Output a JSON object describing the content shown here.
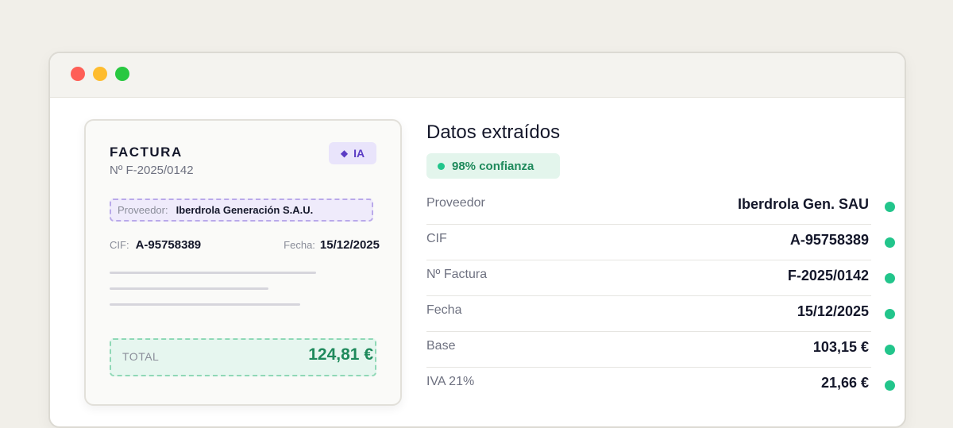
{
  "invoice": {
    "title": "FACTURA",
    "number": "Nº F-2025/0142",
    "ai_badge": "IA",
    "provider_label": "Proveedor:",
    "provider_value": "Iberdrola Generación S.A.U.",
    "cif_label": "CIF:",
    "cif_value": "A-95758389",
    "date_label": "Fecha:",
    "date_value": "15/12/2025",
    "total_label": "TOTAL",
    "total_value": "124,81 €"
  },
  "panel": {
    "title": "Datos extraídos",
    "confidence": "98% confianza",
    "fields": [
      {
        "label": "Proveedor",
        "value": "Iberdrola Gen. SAU"
      },
      {
        "label": "CIF",
        "value": "A-95758389"
      },
      {
        "label": "Nº Factura",
        "value": "F-2025/0142"
      },
      {
        "label": "Fecha",
        "value": "15/12/2025"
      },
      {
        "label": "Base",
        "value": "103,15 €"
      },
      {
        "label": "IVA 21%",
        "value": "21,66 €"
      }
    ]
  },
  "colors": {
    "accent_green": "#22c58b",
    "ai_purple": "#5b3cc4",
    "total_green": "#1f8a5c"
  },
  "icons": {
    "ai": "diamond-icon",
    "verified": "status-dot-icon"
  }
}
